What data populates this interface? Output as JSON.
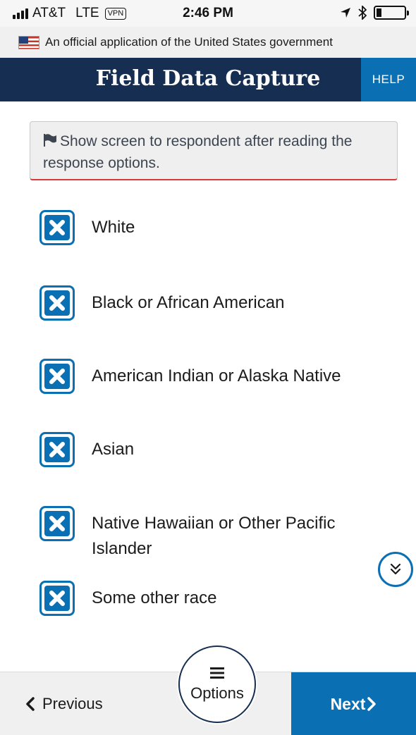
{
  "status_bar": {
    "carrier": "AT&T",
    "network": "LTE",
    "vpn": "VPN",
    "time": "2:46 PM"
  },
  "gov_banner": {
    "text": "An official application of the United States government"
  },
  "header": {
    "title": "Field Data Capture",
    "help_label": "HELP"
  },
  "alert": {
    "text": "Show screen to respondent after reading the response options."
  },
  "options": [
    {
      "label": "White"
    },
    {
      "label": "Black or African American"
    },
    {
      "label": "American Indian or Alaska Native"
    },
    {
      "label": "Asian"
    },
    {
      "label": "Native Hawaiian or Other Pacific Islander"
    },
    {
      "label": "Some other race"
    }
  ],
  "footer": {
    "previous_label": "Previous",
    "options_label": "Options",
    "next_label": "Next"
  },
  "colors": {
    "header_bg": "#162e51",
    "primary": "#0b6fb3",
    "alert_border": "#d83a3a"
  }
}
